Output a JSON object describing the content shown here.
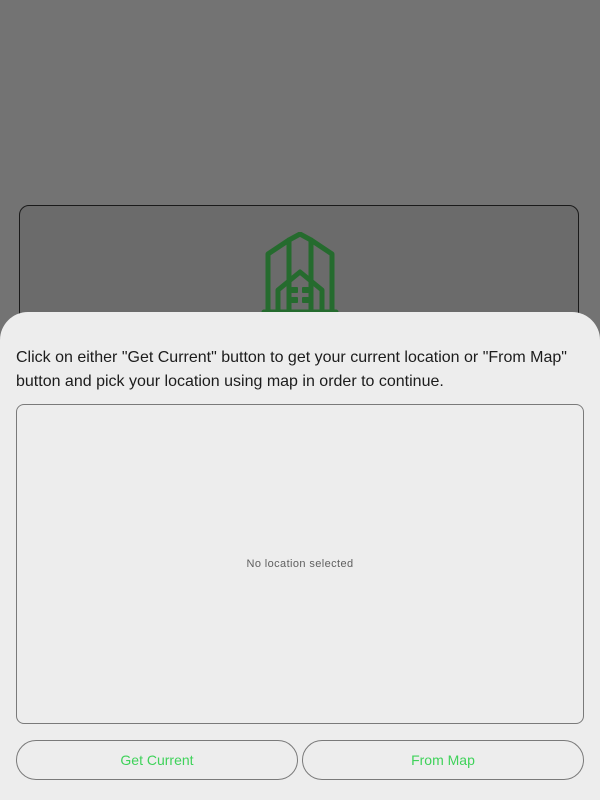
{
  "background": {
    "icon": "building-icon",
    "icon_color": "#256b2e"
  },
  "sheet": {
    "instructions": "Click on either \"Get Current\" button to get your current location or \"From Map\" button and pick your location using map in order to continue.",
    "location_status": "No location selected",
    "buttons": {
      "get_current": "Get Current",
      "from_map": "From Map"
    },
    "accent_color": "#3fd25a"
  }
}
